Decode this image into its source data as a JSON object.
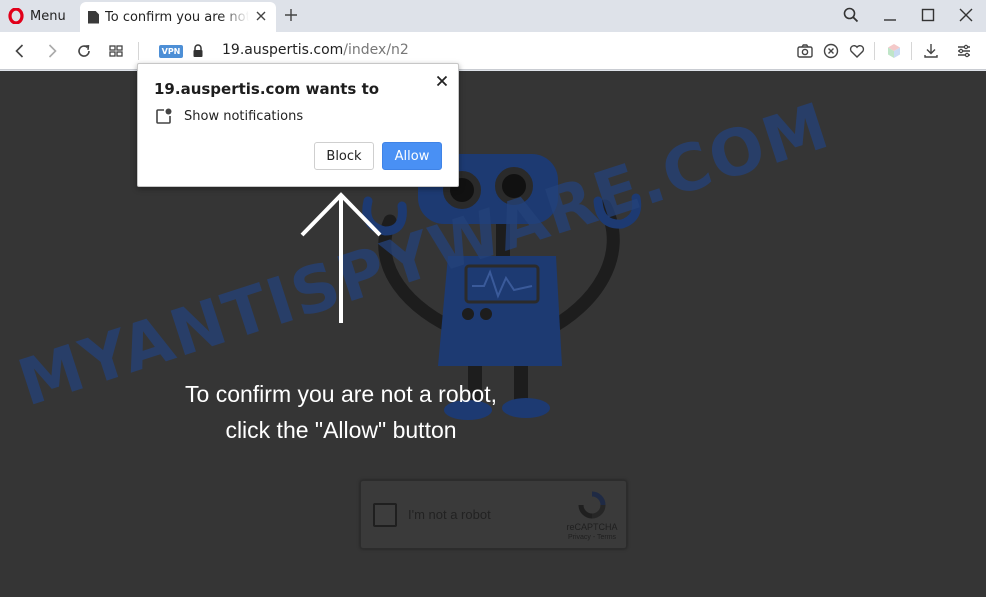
{
  "browser": {
    "menu_label": "Menu",
    "tab": {
      "title": "To confirm you are not a robot, click the \"Allow\" button"
    },
    "address": {
      "vpn_badge": "VPN",
      "url_host": "19.auspertis.com",
      "url_path": "/index/n2"
    }
  },
  "popup": {
    "title": "19.auspertis.com wants to",
    "permission": "Show notifications",
    "block_label": "Block",
    "allow_label": "Allow",
    "allow_color": "#4990f4"
  },
  "page": {
    "message_line1": "To confirm you are not a robot,",
    "message_line2": "click the \"Allow\" button",
    "watermark": "MYANTISPYWARE.COM",
    "background_color": "#353535",
    "captcha": {
      "label": "I'm not a robot",
      "brand": "reCAPTCHA",
      "links": "Privacy - Terms"
    }
  },
  "icons": [
    "opera-logo-icon",
    "document-icon",
    "close-icon",
    "plus-icon",
    "search-icon",
    "minimize-icon",
    "maximize-icon",
    "window-close-icon",
    "back-icon",
    "forward-icon",
    "reload-icon",
    "speed-dial-icon",
    "lock-icon",
    "camera-icon",
    "block-ads-icon",
    "heart-icon",
    "wallet-icon",
    "download-icon",
    "settings-icon",
    "notification-icon",
    "recaptcha-logo-icon",
    "up-arrow-icon"
  ]
}
